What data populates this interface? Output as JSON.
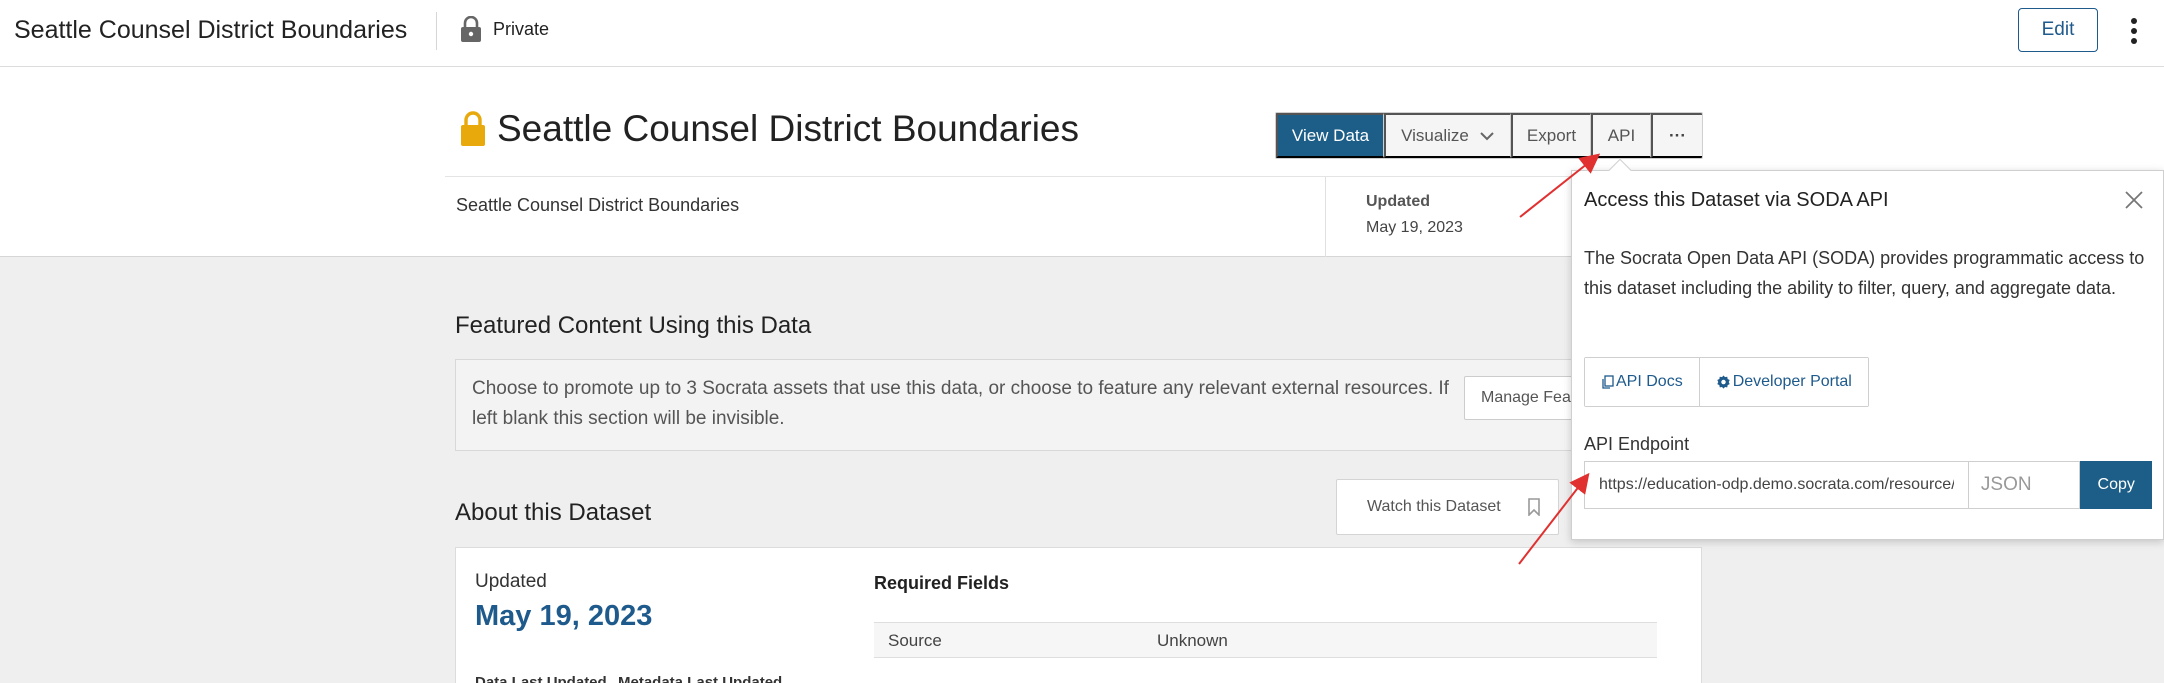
{
  "header": {
    "title": "Seattle Counsel District Boundaries",
    "visibility": "Private",
    "edit_label": "Edit"
  },
  "dataset": {
    "title": "Seattle Counsel District Boundaries",
    "description": "Seattle Counsel District Boundaries",
    "updated_label": "Updated",
    "updated_value": "May 19, 2023"
  },
  "actions": {
    "view_data": "View Data",
    "visualize": "Visualize",
    "export": "Export",
    "api": "API",
    "more": "···"
  },
  "featured": {
    "heading": "Featured Content Using this Data",
    "text": "Choose to promote up to 3 Socrata assets that use this data, or choose to feature any relevant external resources. If left blank this section will be invisible.",
    "manage_label": "Manage Featured Content"
  },
  "about": {
    "heading": "About this Dataset",
    "watch_label": "Watch this Dataset",
    "updated_label": "Updated",
    "updated_value": "May 19, 2023",
    "data_last_updated_label": "Data Last Updated",
    "metadata_last_updated_label": "Metadata Last Updated",
    "required_fields_title": "Required Fields",
    "required_fields": [
      {
        "key": "Source",
        "value": "Unknown"
      }
    ]
  },
  "api_popover": {
    "title": "Access this Dataset via SODA API",
    "description": "The Socrata Open Data API (SODA) provides programmatic access to this dataset including the ability to filter, query, and aggregate data.",
    "api_docs_label": "API Docs",
    "developer_portal_label": "Developer Portal",
    "endpoint_label": "API Endpoint",
    "endpoint_value": "https://education-odp.demo.socrata.com/resource/",
    "format_value": "JSON",
    "copy_label": "Copy"
  },
  "colors": {
    "primary": "#1c5e87",
    "link": "#1e5a8c",
    "lock_gold": "#e8a90c",
    "annotation_red": "#e03030"
  },
  "icons": {
    "header_lock": "lock-icon",
    "title_lock": "lock-icon",
    "kebab": "kebab-menu-icon",
    "close": "close-icon",
    "docs": "document-copy-icon",
    "portal": "gear-icon",
    "watch": "bookmark-icon",
    "visualize_chevron": "chevron-down-icon"
  }
}
